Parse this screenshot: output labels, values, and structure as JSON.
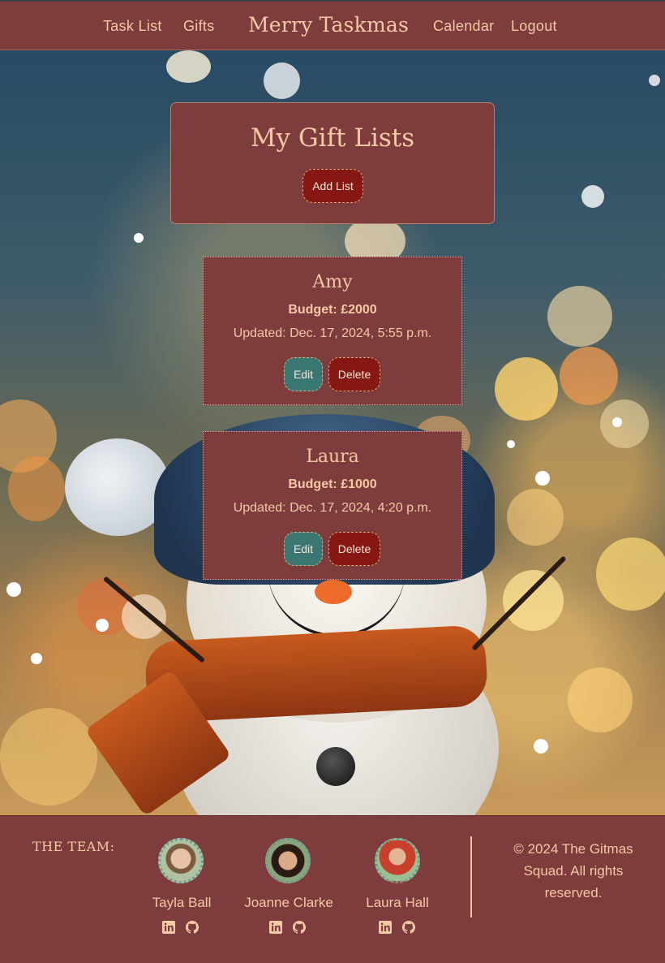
{
  "nav": {
    "task_list": "Task List",
    "gifts": "Gifts",
    "brand": "Merry Taskmas",
    "calendar": "Calendar",
    "logout": "Logout"
  },
  "page": {
    "title": "My Gift Lists",
    "add_button": "Add List"
  },
  "gift_lists": [
    {
      "name": "Amy",
      "budget": "Budget: £2000",
      "updated": "Updated: Dec. 17, 2024, 5:55 p.m.",
      "edit": "Edit",
      "delete": "Delete"
    },
    {
      "name": "Laura",
      "budget": "Budget: £1000",
      "updated": "Updated: Dec. 17, 2024, 4:20 p.m.",
      "edit": "Edit",
      "delete": "Delete"
    }
  ],
  "footer": {
    "team_label": "THE TEAM:",
    "members": [
      {
        "name": "Tayla Ball",
        "icons": [
          "linkedin-icon",
          "github-icon"
        ]
      },
      {
        "name": "Joanne Clarke",
        "icons": [
          "linkedin-icon",
          "github-icon"
        ]
      },
      {
        "name": "Laura Hall",
        "icons": [
          "linkedin-icon",
          "github-icon"
        ]
      }
    ],
    "copyright": "© 2024 The Gitmas Squad. All rights reserved."
  },
  "colors": {
    "primary": "#7f3c3c",
    "accent_text": "#f4c9a6",
    "delete_button": "#861712",
    "edit_button": "#3a7672"
  }
}
